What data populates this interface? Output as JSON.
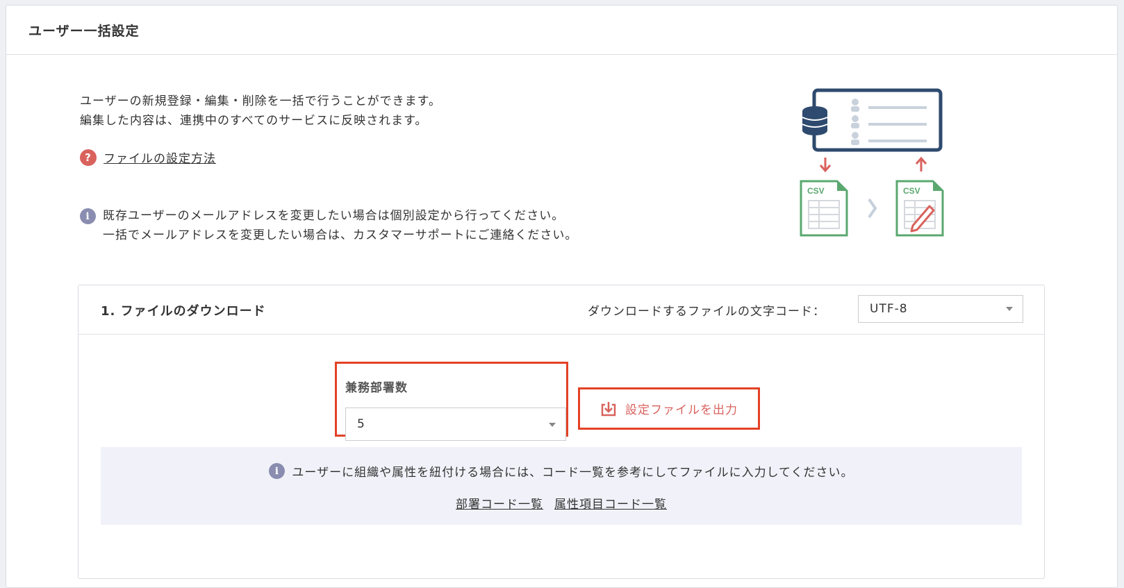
{
  "header": {
    "title": "ユーザー一括設定"
  },
  "intro": {
    "line1": "ユーザーの新規登録・編集・削除を一括で行うことができます。",
    "line2": "編集した内容は、連携中のすべてのサービスに反映されます。"
  },
  "help": {
    "icon": "question-icon",
    "link": "ファイルの設定方法",
    "color": "#d9625d"
  },
  "notice": {
    "line1": "既存ユーザーのメールアドレスを変更したい場合は個別設定から行ってください。",
    "line2": "一括でメールアドレスを変更したい場合は、カスタマーサポートにご連絡ください。"
  },
  "illustration": {
    "csv_left": "CSV",
    "csv_right": "CSV"
  },
  "download_section": {
    "title": "1. ファイルのダウンロード",
    "encoding_label": "ダウンロードするファイルの文字コード：",
    "encoding_value": "UTF-8",
    "dept_count_label": "兼務部署数",
    "dept_count_value": "5",
    "export_button": "設定ファイルを出力",
    "info_text": "ユーザーに組織や属性を紐付ける場合には、コード一覧を参考にしてファイルに入力してください。",
    "links": [
      "部署コード一覧",
      "属性項目コード一覧"
    ]
  },
  "colors": {
    "accent": "#d9625d",
    "highlight": "#e34126",
    "navy": "#2e4a6e",
    "green": "#5aa86f",
    "info": "#8a8db0"
  }
}
